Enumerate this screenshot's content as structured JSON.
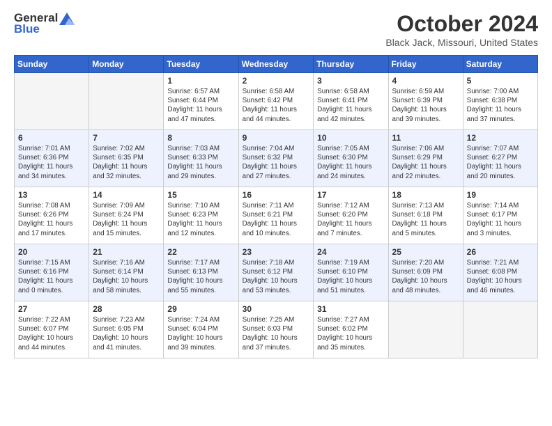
{
  "header": {
    "logo_general": "General",
    "logo_blue": "Blue",
    "title": "October 2024",
    "location": "Black Jack, Missouri, United States"
  },
  "days_of_week": [
    "Sunday",
    "Monday",
    "Tuesday",
    "Wednesday",
    "Thursday",
    "Friday",
    "Saturday"
  ],
  "weeks": [
    [
      {
        "num": "",
        "info": ""
      },
      {
        "num": "",
        "info": ""
      },
      {
        "num": "1",
        "info": "Sunrise: 6:57 AM\nSunset: 6:44 PM\nDaylight: 11 hours and 47 minutes."
      },
      {
        "num": "2",
        "info": "Sunrise: 6:58 AM\nSunset: 6:42 PM\nDaylight: 11 hours and 44 minutes."
      },
      {
        "num": "3",
        "info": "Sunrise: 6:58 AM\nSunset: 6:41 PM\nDaylight: 11 hours and 42 minutes."
      },
      {
        "num": "4",
        "info": "Sunrise: 6:59 AM\nSunset: 6:39 PM\nDaylight: 11 hours and 39 minutes."
      },
      {
        "num": "5",
        "info": "Sunrise: 7:00 AM\nSunset: 6:38 PM\nDaylight: 11 hours and 37 minutes."
      }
    ],
    [
      {
        "num": "6",
        "info": "Sunrise: 7:01 AM\nSunset: 6:36 PM\nDaylight: 11 hours and 34 minutes."
      },
      {
        "num": "7",
        "info": "Sunrise: 7:02 AM\nSunset: 6:35 PM\nDaylight: 11 hours and 32 minutes."
      },
      {
        "num": "8",
        "info": "Sunrise: 7:03 AM\nSunset: 6:33 PM\nDaylight: 11 hours and 29 minutes."
      },
      {
        "num": "9",
        "info": "Sunrise: 7:04 AM\nSunset: 6:32 PM\nDaylight: 11 hours and 27 minutes."
      },
      {
        "num": "10",
        "info": "Sunrise: 7:05 AM\nSunset: 6:30 PM\nDaylight: 11 hours and 24 minutes."
      },
      {
        "num": "11",
        "info": "Sunrise: 7:06 AM\nSunset: 6:29 PM\nDaylight: 11 hours and 22 minutes."
      },
      {
        "num": "12",
        "info": "Sunrise: 7:07 AM\nSunset: 6:27 PM\nDaylight: 11 hours and 20 minutes."
      }
    ],
    [
      {
        "num": "13",
        "info": "Sunrise: 7:08 AM\nSunset: 6:26 PM\nDaylight: 11 hours and 17 minutes."
      },
      {
        "num": "14",
        "info": "Sunrise: 7:09 AM\nSunset: 6:24 PM\nDaylight: 11 hours and 15 minutes."
      },
      {
        "num": "15",
        "info": "Sunrise: 7:10 AM\nSunset: 6:23 PM\nDaylight: 11 hours and 12 minutes."
      },
      {
        "num": "16",
        "info": "Sunrise: 7:11 AM\nSunset: 6:21 PM\nDaylight: 11 hours and 10 minutes."
      },
      {
        "num": "17",
        "info": "Sunrise: 7:12 AM\nSunset: 6:20 PM\nDaylight: 11 hours and 7 minutes."
      },
      {
        "num": "18",
        "info": "Sunrise: 7:13 AM\nSunset: 6:18 PM\nDaylight: 11 hours and 5 minutes."
      },
      {
        "num": "19",
        "info": "Sunrise: 7:14 AM\nSunset: 6:17 PM\nDaylight: 11 hours and 3 minutes."
      }
    ],
    [
      {
        "num": "20",
        "info": "Sunrise: 7:15 AM\nSunset: 6:16 PM\nDaylight: 11 hours and 0 minutes."
      },
      {
        "num": "21",
        "info": "Sunrise: 7:16 AM\nSunset: 6:14 PM\nDaylight: 10 hours and 58 minutes."
      },
      {
        "num": "22",
        "info": "Sunrise: 7:17 AM\nSunset: 6:13 PM\nDaylight: 10 hours and 55 minutes."
      },
      {
        "num": "23",
        "info": "Sunrise: 7:18 AM\nSunset: 6:12 PM\nDaylight: 10 hours and 53 minutes."
      },
      {
        "num": "24",
        "info": "Sunrise: 7:19 AM\nSunset: 6:10 PM\nDaylight: 10 hours and 51 minutes."
      },
      {
        "num": "25",
        "info": "Sunrise: 7:20 AM\nSunset: 6:09 PM\nDaylight: 10 hours and 48 minutes."
      },
      {
        "num": "26",
        "info": "Sunrise: 7:21 AM\nSunset: 6:08 PM\nDaylight: 10 hours and 46 minutes."
      }
    ],
    [
      {
        "num": "27",
        "info": "Sunrise: 7:22 AM\nSunset: 6:07 PM\nDaylight: 10 hours and 44 minutes."
      },
      {
        "num": "28",
        "info": "Sunrise: 7:23 AM\nSunset: 6:05 PM\nDaylight: 10 hours and 41 minutes."
      },
      {
        "num": "29",
        "info": "Sunrise: 7:24 AM\nSunset: 6:04 PM\nDaylight: 10 hours and 39 minutes."
      },
      {
        "num": "30",
        "info": "Sunrise: 7:25 AM\nSunset: 6:03 PM\nDaylight: 10 hours and 37 minutes."
      },
      {
        "num": "31",
        "info": "Sunrise: 7:27 AM\nSunset: 6:02 PM\nDaylight: 10 hours and 35 minutes."
      },
      {
        "num": "",
        "info": ""
      },
      {
        "num": "",
        "info": ""
      }
    ]
  ]
}
